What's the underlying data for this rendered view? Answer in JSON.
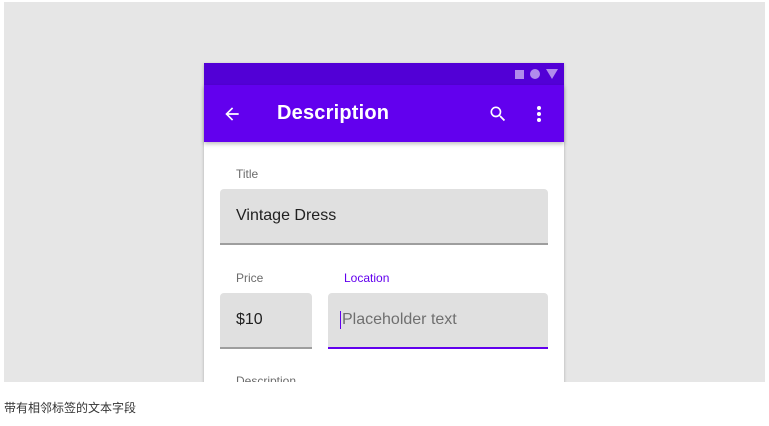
{
  "app_bar": {
    "title": "Description",
    "background_color": "#6200ee",
    "status_bar_color": "#5200d6",
    "icons": [
      "arrow-back-icon",
      "search-icon",
      "more-vert-icon"
    ]
  },
  "status_bar": {
    "icons": [
      "square-icon",
      "circle-icon",
      "triangle-icon"
    ]
  },
  "form": {
    "title": {
      "label": "Title",
      "value": "Vintage Dress"
    },
    "price": {
      "label": "Price",
      "value": "$10"
    },
    "location": {
      "label": "Location",
      "placeholder": "Placeholder text",
      "focused": true
    },
    "description": {
      "label": "Description"
    },
    "accent_color": "#6200ee"
  },
  "caption": "带有相邻标签的文本字段"
}
